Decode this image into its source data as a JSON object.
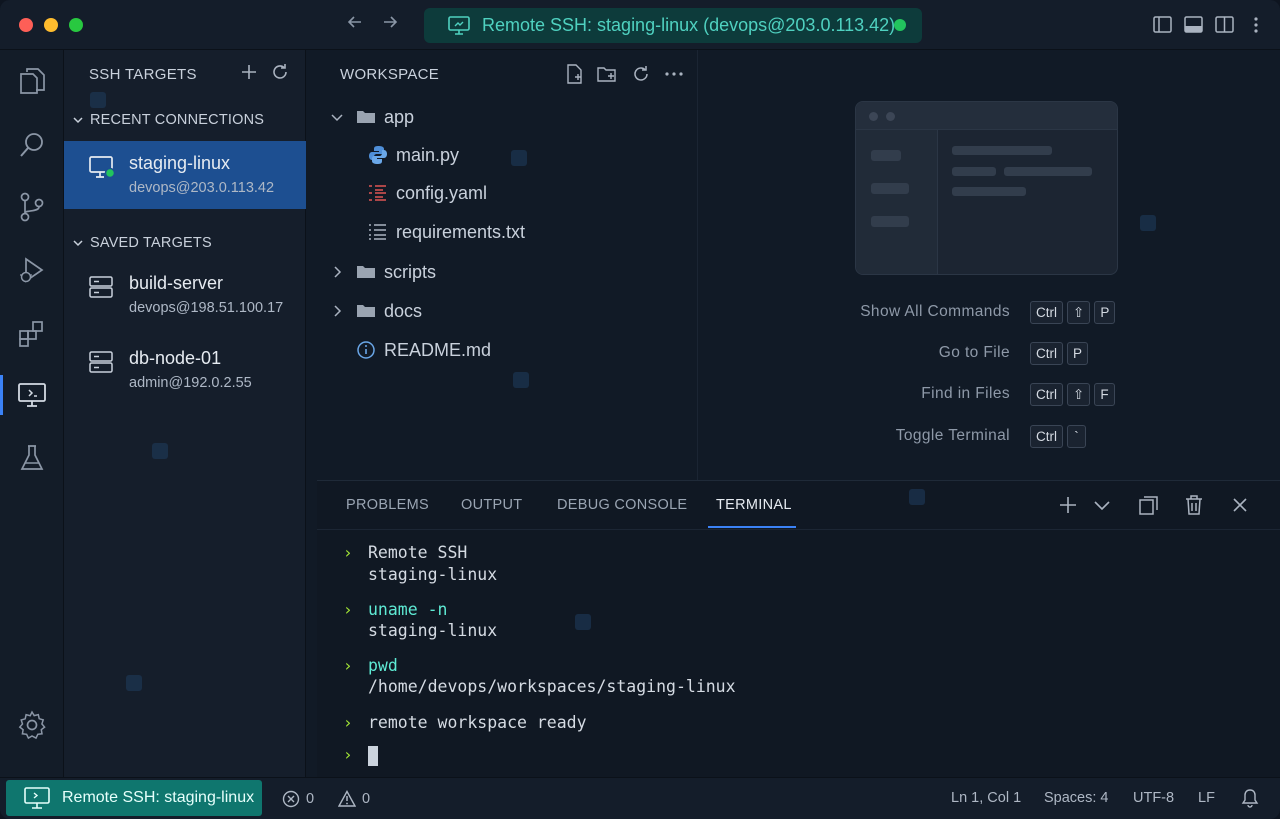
{
  "titlebar": {
    "remote_label": "Remote SSH: staging-linux (devops@203.0.113.42)",
    "back_icon": "arrow-left-icon",
    "forward_icon": "arrow-right-icon"
  },
  "sidebar": {
    "title": "SSH TARGETS",
    "recent_title": "RECENT CONNECTIONS",
    "saved_title": "SAVED TARGETS",
    "recent": [
      {
        "name": "staging-linux",
        "host": "devops@203.0.113.42"
      }
    ],
    "saved": [
      {
        "name": "build-server",
        "host": "devops@198.51.100.17"
      },
      {
        "name": "db-node-01",
        "host": "admin@192.0.2.55"
      }
    ]
  },
  "explorer": {
    "title": "WORKSPACE",
    "tree": [
      {
        "label": "app",
        "type": "folder-open"
      },
      {
        "label": "main.py",
        "type": "python"
      },
      {
        "label": "config.yaml",
        "type": "yaml"
      },
      {
        "label": "requirements.txt",
        "type": "text"
      },
      {
        "label": "scripts",
        "type": "folder"
      },
      {
        "label": "docs",
        "type": "folder"
      },
      {
        "label": "README.md",
        "type": "info"
      }
    ]
  },
  "welcome": {
    "shortcuts": [
      {
        "label": "Show All Commands",
        "keys": [
          "Ctrl",
          "⇧",
          "P"
        ]
      },
      {
        "label": "Go to File",
        "keys": [
          "Ctrl",
          "P"
        ]
      },
      {
        "label": "Find in Files",
        "keys": [
          "Ctrl",
          "⇧",
          "F"
        ]
      },
      {
        "label": "Toggle Terminal",
        "keys": [
          "Ctrl",
          "`"
        ]
      }
    ]
  },
  "panel": {
    "tabs": [
      "PROBLEMS",
      "OUTPUT",
      "DEBUG CONSOLE",
      "TERMINAL"
    ],
    "active_tab": "TERMINAL",
    "terminal": [
      {
        "cmd": "Remote SSH",
        "out": "staging-linux",
        "cmd_colored": false
      },
      {
        "cmd": "uname -n",
        "out": "staging-linux",
        "cmd_colored": true
      },
      {
        "cmd": "pwd",
        "out": "/home/devops/workspaces/staging-linux",
        "cmd_colored": true
      },
      {
        "cmd": "remote workspace ready",
        "out": "",
        "cmd_colored": false
      }
    ],
    "prompt": "›"
  },
  "statusbar": {
    "remote": "Remote SSH: staging-linux",
    "errors": "0",
    "warnings": "0",
    "position": "Ln 1, Col 1",
    "spaces": "Spaces: 4",
    "encoding": "UTF-8",
    "eol": "LF"
  },
  "colors": {
    "accent": "#3b82f6",
    "remote": "#0f766e",
    "remote_text": "#4fd1c0",
    "online": "#22c55e"
  }
}
